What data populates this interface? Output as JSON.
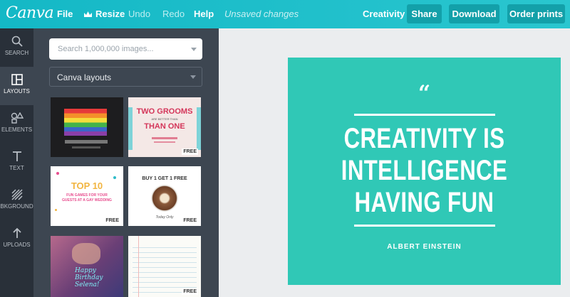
{
  "app": {
    "logo": "Canva"
  },
  "topbar": {
    "file": "File",
    "resize": "Resize",
    "undo": "Undo",
    "redo": "Redo",
    "help": "Help",
    "status": "Unsaved changes",
    "title": "Creativity",
    "share": "Share",
    "download": "Download",
    "order": "Order prints"
  },
  "rail": [
    {
      "label": "SEARCH",
      "icon": "search-icon"
    },
    {
      "label": "LAYOUTS",
      "icon": "layouts-icon"
    },
    {
      "label": "ELEMENTS",
      "icon": "elements-icon"
    },
    {
      "label": "TEXT",
      "icon": "text-icon"
    },
    {
      "label": "BKGROUND",
      "icon": "background-icon"
    },
    {
      "label": "UPLOADS",
      "icon": "upload-icon"
    }
  ],
  "panel": {
    "search_placeholder": "Search 1,000,000 images...",
    "layouts_select": "Canva layouts",
    "thumbs": [
      {
        "title": "",
        "free": ""
      },
      {
        "title": "TWO GROOMS",
        "sub": "ARE BETTER THAN",
        "title2": "THAN ONE",
        "free": "FREE"
      },
      {
        "title": "TOP 10",
        "sub": "FUN GAMES FOR YOUR GUESTS AT A GAY WEDDING",
        "free": "FREE"
      },
      {
        "title": "BUY 1 GET 1 FREE",
        "sub": "Today Only",
        "free": "FREE"
      },
      {
        "title": "Happy Birthday Selena!",
        "free": ""
      },
      {
        "title": "",
        "free": "FREE"
      }
    ]
  },
  "design": {
    "quote": "“",
    "line1": "CREATIVITY IS",
    "line2": "INTELLIGENCE",
    "line3": "HAVING FUN",
    "author": "ALBERT EINSTEIN",
    "background": "#30c8b6"
  },
  "colors": {
    "topbar": "#21c2cc",
    "rail": "#293039",
    "panel": "#3d4651",
    "canvas_bg": "#ebedef"
  }
}
